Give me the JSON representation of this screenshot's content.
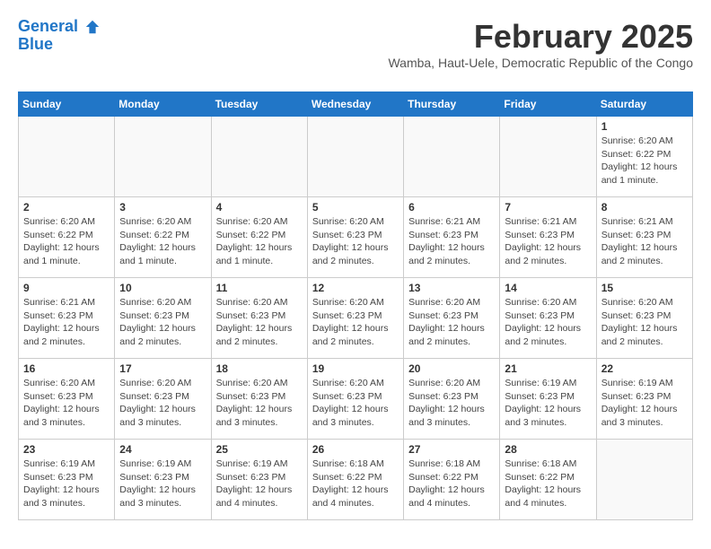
{
  "logo": {
    "line1": "General",
    "line2": "Blue"
  },
  "title": "February 2025",
  "location": "Wamba, Haut-Uele, Democratic Republic of the Congo",
  "days_of_week": [
    "Sunday",
    "Monday",
    "Tuesday",
    "Wednesday",
    "Thursday",
    "Friday",
    "Saturday"
  ],
  "weeks": [
    [
      {
        "day": "",
        "info": ""
      },
      {
        "day": "",
        "info": ""
      },
      {
        "day": "",
        "info": ""
      },
      {
        "day": "",
        "info": ""
      },
      {
        "day": "",
        "info": ""
      },
      {
        "day": "",
        "info": ""
      },
      {
        "day": "1",
        "info": "Sunrise: 6:20 AM\nSunset: 6:22 PM\nDaylight: 12 hours\nand 1 minute."
      }
    ],
    [
      {
        "day": "2",
        "info": "Sunrise: 6:20 AM\nSunset: 6:22 PM\nDaylight: 12 hours\nand 1 minute."
      },
      {
        "day": "3",
        "info": "Sunrise: 6:20 AM\nSunset: 6:22 PM\nDaylight: 12 hours\nand 1 minute."
      },
      {
        "day": "4",
        "info": "Sunrise: 6:20 AM\nSunset: 6:22 PM\nDaylight: 12 hours\nand 1 minute."
      },
      {
        "day": "5",
        "info": "Sunrise: 6:20 AM\nSunset: 6:23 PM\nDaylight: 12 hours\nand 2 minutes."
      },
      {
        "day": "6",
        "info": "Sunrise: 6:21 AM\nSunset: 6:23 PM\nDaylight: 12 hours\nand 2 minutes."
      },
      {
        "day": "7",
        "info": "Sunrise: 6:21 AM\nSunset: 6:23 PM\nDaylight: 12 hours\nand 2 minutes."
      },
      {
        "day": "8",
        "info": "Sunrise: 6:21 AM\nSunset: 6:23 PM\nDaylight: 12 hours\nand 2 minutes."
      }
    ],
    [
      {
        "day": "9",
        "info": "Sunrise: 6:21 AM\nSunset: 6:23 PM\nDaylight: 12 hours\nand 2 minutes."
      },
      {
        "day": "10",
        "info": "Sunrise: 6:20 AM\nSunset: 6:23 PM\nDaylight: 12 hours\nand 2 minutes."
      },
      {
        "day": "11",
        "info": "Sunrise: 6:20 AM\nSunset: 6:23 PM\nDaylight: 12 hours\nand 2 minutes."
      },
      {
        "day": "12",
        "info": "Sunrise: 6:20 AM\nSunset: 6:23 PM\nDaylight: 12 hours\nand 2 minutes."
      },
      {
        "day": "13",
        "info": "Sunrise: 6:20 AM\nSunset: 6:23 PM\nDaylight: 12 hours\nand 2 minutes."
      },
      {
        "day": "14",
        "info": "Sunrise: 6:20 AM\nSunset: 6:23 PM\nDaylight: 12 hours\nand 2 minutes."
      },
      {
        "day": "15",
        "info": "Sunrise: 6:20 AM\nSunset: 6:23 PM\nDaylight: 12 hours\nand 2 minutes."
      }
    ],
    [
      {
        "day": "16",
        "info": "Sunrise: 6:20 AM\nSunset: 6:23 PM\nDaylight: 12 hours\nand 3 minutes."
      },
      {
        "day": "17",
        "info": "Sunrise: 6:20 AM\nSunset: 6:23 PM\nDaylight: 12 hours\nand 3 minutes."
      },
      {
        "day": "18",
        "info": "Sunrise: 6:20 AM\nSunset: 6:23 PM\nDaylight: 12 hours\nand 3 minutes."
      },
      {
        "day": "19",
        "info": "Sunrise: 6:20 AM\nSunset: 6:23 PM\nDaylight: 12 hours\nand 3 minutes."
      },
      {
        "day": "20",
        "info": "Sunrise: 6:20 AM\nSunset: 6:23 PM\nDaylight: 12 hours\nand 3 minutes."
      },
      {
        "day": "21",
        "info": "Sunrise: 6:19 AM\nSunset: 6:23 PM\nDaylight: 12 hours\nand 3 minutes."
      },
      {
        "day": "22",
        "info": "Sunrise: 6:19 AM\nSunset: 6:23 PM\nDaylight: 12 hours\nand 3 minutes."
      }
    ],
    [
      {
        "day": "23",
        "info": "Sunrise: 6:19 AM\nSunset: 6:23 PM\nDaylight: 12 hours\nand 3 minutes."
      },
      {
        "day": "24",
        "info": "Sunrise: 6:19 AM\nSunset: 6:23 PM\nDaylight: 12 hours\nand 3 minutes."
      },
      {
        "day": "25",
        "info": "Sunrise: 6:19 AM\nSunset: 6:23 PM\nDaylight: 12 hours\nand 4 minutes."
      },
      {
        "day": "26",
        "info": "Sunrise: 6:18 AM\nSunset: 6:22 PM\nDaylight: 12 hours\nand 4 minutes."
      },
      {
        "day": "27",
        "info": "Sunrise: 6:18 AM\nSunset: 6:22 PM\nDaylight: 12 hours\nand 4 minutes."
      },
      {
        "day": "28",
        "info": "Sunrise: 6:18 AM\nSunset: 6:22 PM\nDaylight: 12 hours\nand 4 minutes."
      },
      {
        "day": "",
        "info": ""
      }
    ]
  ]
}
